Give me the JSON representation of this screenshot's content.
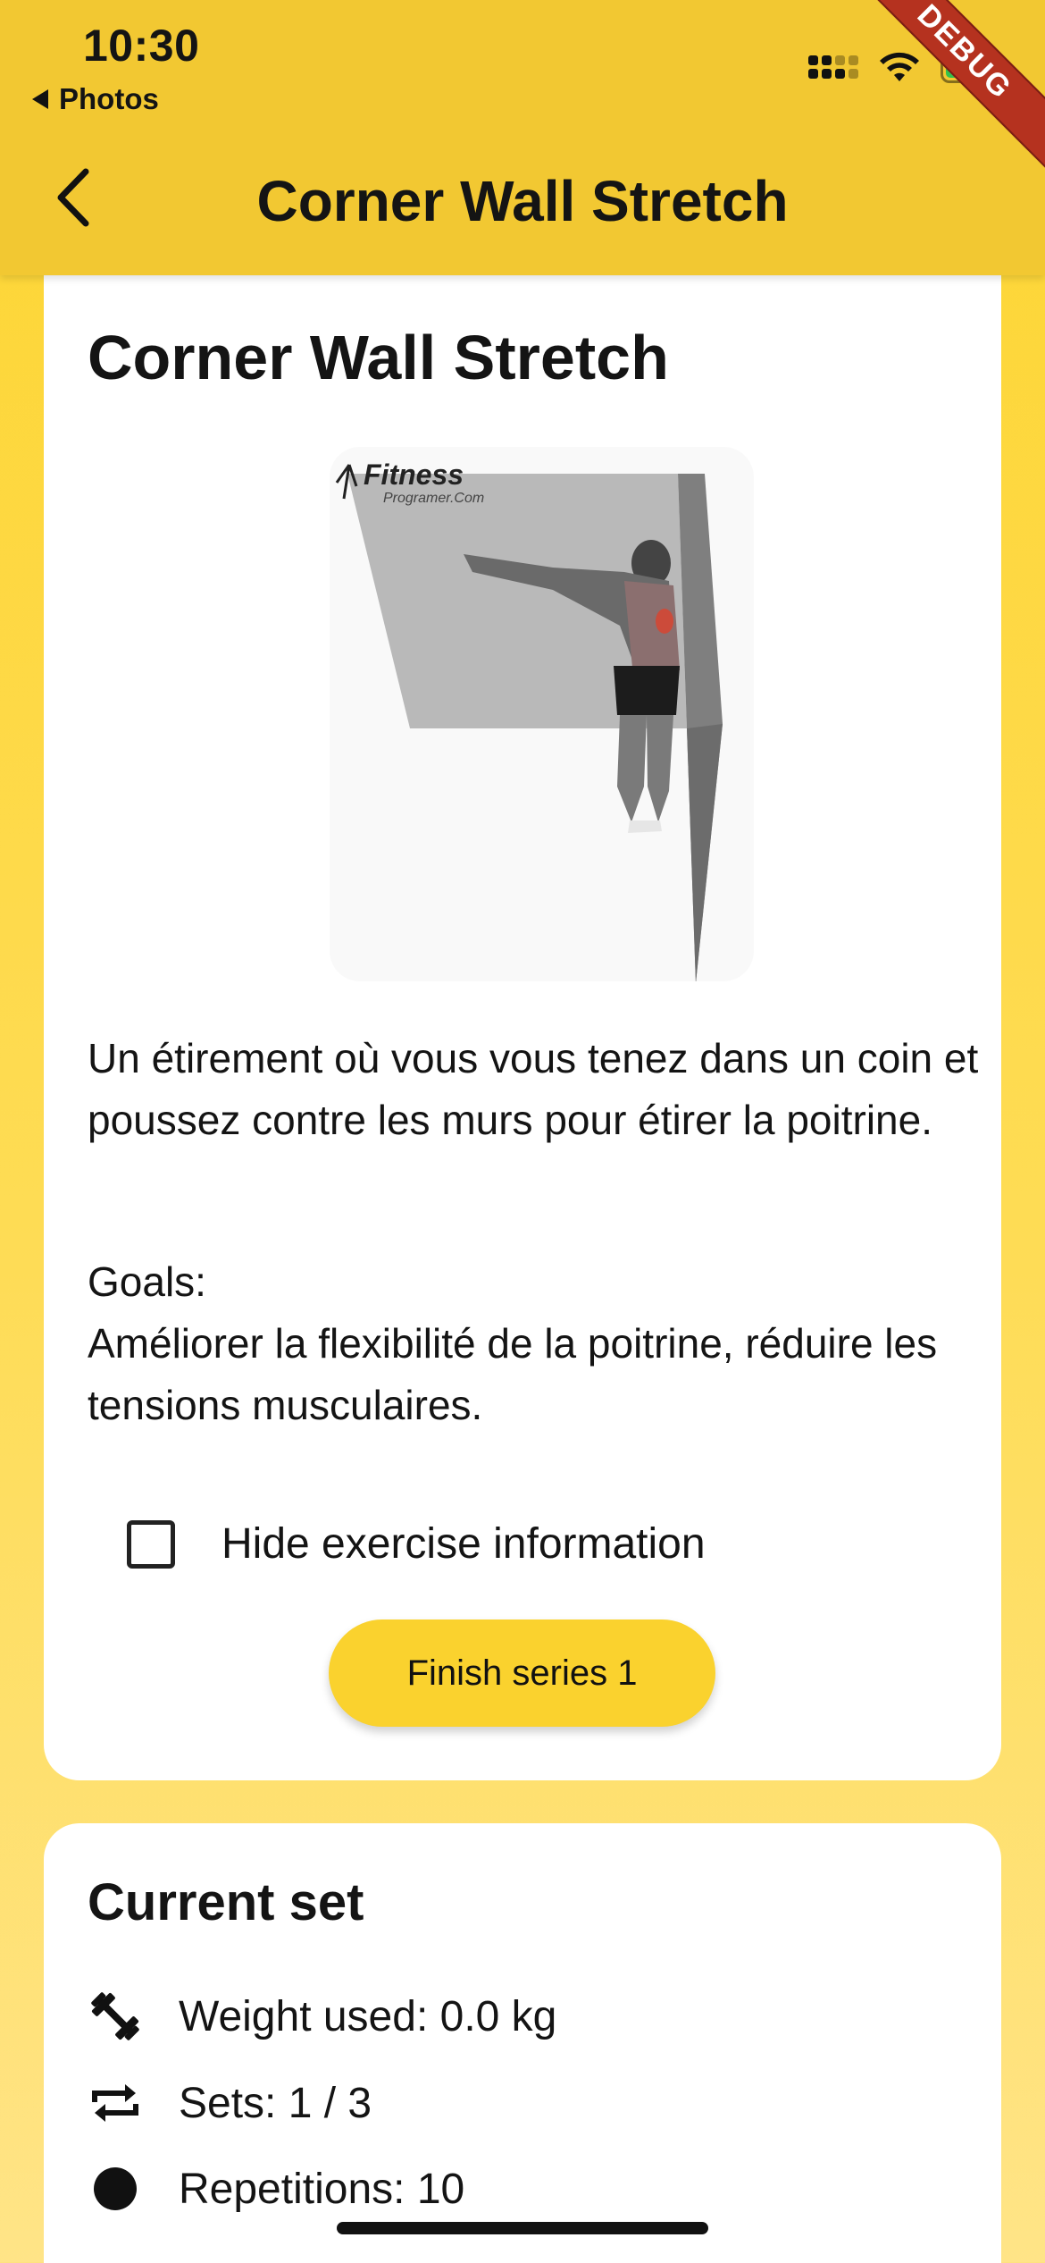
{
  "status_bar": {
    "time": "10:30",
    "back_app": "Photos",
    "icons": [
      "cellular-signal-icon",
      "wifi-icon",
      "battery-charging-icon"
    ]
  },
  "debug_banner": "DEBUG",
  "app_bar": {
    "title": "Corner Wall Stretch",
    "back_icon": "chevron-left-icon"
  },
  "exercise": {
    "title": "Corner Wall Stretch",
    "image_watermark": {
      "brand": "Fitness",
      "sub": "Programer.Com"
    },
    "description": "Un étirement où vous vous tenez dans un coin et poussez contre les murs pour étirer la poitrine.",
    "goals_label": "Goals:",
    "goals_text": "Améliorer la flexibilité de la poitrine, réduire les tensions musculaires.",
    "hide_info_label": "Hide exercise information",
    "hide_info_checked": false,
    "finish_button": "Finish series 1"
  },
  "current_set": {
    "title": "Current set",
    "weight": "Weight used: 0.0 kg",
    "sets": "Sets: 1 / 3",
    "repetitions": "Repetitions: 10"
  },
  "colors": {
    "app_bar": "#F2C832",
    "background_top": "#FDD532",
    "background_bottom": "#FFE487",
    "button": "#FAD22E",
    "debug_ribbon": "#B5321F"
  }
}
